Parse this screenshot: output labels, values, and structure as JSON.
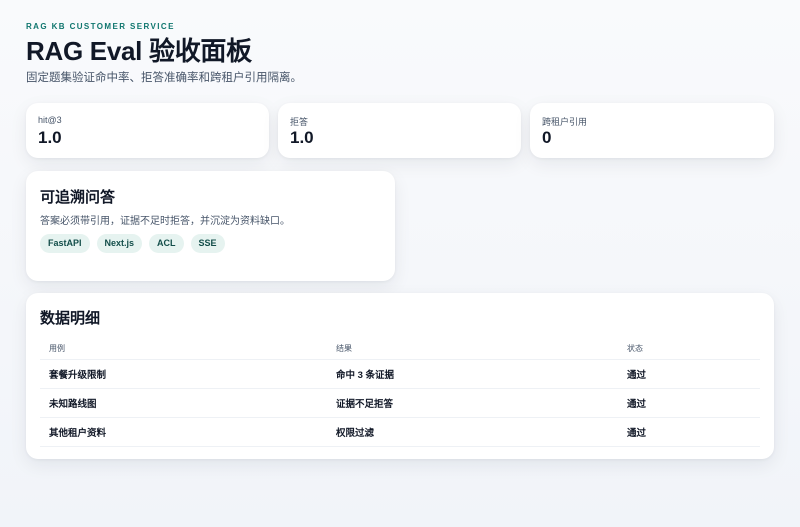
{
  "header": {
    "eyebrow": "RAG KB CUSTOMER SERVICE",
    "title": "RAG Eval 验收面板",
    "subtitle": "固定题集验证命中率、拒答准确率和跨租户引用隔离。"
  },
  "metrics": [
    {
      "label": "hit@3",
      "value": "1.0"
    },
    {
      "label": "拒答",
      "value": "1.0"
    },
    {
      "label": "跨租户引用",
      "value": "0"
    }
  ],
  "traceable": {
    "title": "可追溯问答",
    "description": "答案必须带引用，证据不足时拒答，并沉淀为资料缺口。",
    "tags": [
      "FastAPI",
      "Next.js",
      "ACL",
      "SSE"
    ]
  },
  "details": {
    "title": "数据明细",
    "columns": [
      "用例",
      "结果",
      "状态"
    ],
    "rows": [
      [
        "套餐升级限制",
        "命中 3 条证据",
        "通过"
      ],
      [
        "未知路线图",
        "证据不足拒答",
        "通过"
      ],
      [
        "其他租户资料",
        "权限过滤",
        "通过"
      ]
    ]
  },
  "colors": {
    "accent": "#0f766e",
    "tag_bg": "#e6f3f0",
    "text": "#111827",
    "muted": "#475569"
  }
}
